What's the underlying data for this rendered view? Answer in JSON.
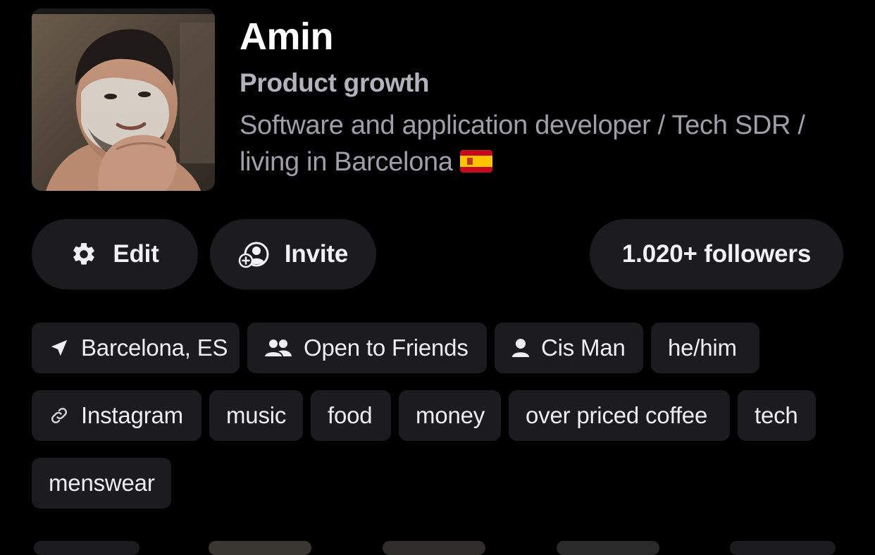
{
  "profile": {
    "name": "Amin",
    "headline": "Product growth",
    "bio": "Software and application developer / Tech SDR / living in Barcelona",
    "flag_icon": "spain-flag-emoji"
  },
  "actions": {
    "edit_label": "Edit",
    "edit_icon": "gear-icon",
    "invite_label": "Invite",
    "invite_icon": "add-person-icon",
    "followers_label": "1.020+ followers"
  },
  "info_chips": [
    {
      "label": "Barcelona, ES",
      "icon": "location-arrow-icon"
    },
    {
      "label": "Open to Friends",
      "icon": "people-icon"
    },
    {
      "label": "Cis Man",
      "icon": "person-icon"
    },
    {
      "label": "he/him",
      "icon": ""
    }
  ],
  "interest_chips": [
    {
      "label": "Instagram",
      "icon": "link-icon"
    },
    {
      "label": "music"
    },
    {
      "label": "food"
    },
    {
      "label": "money"
    },
    {
      "label": "over priced coffee"
    },
    {
      "label": "tech"
    },
    {
      "label": "menswear"
    }
  ],
  "colors": {
    "background": "#000000",
    "surface": "#1c1c1f",
    "text_primary": "#ffffff",
    "text_secondary": "#b4b3bd",
    "text_muted": "#a09fa9"
  }
}
